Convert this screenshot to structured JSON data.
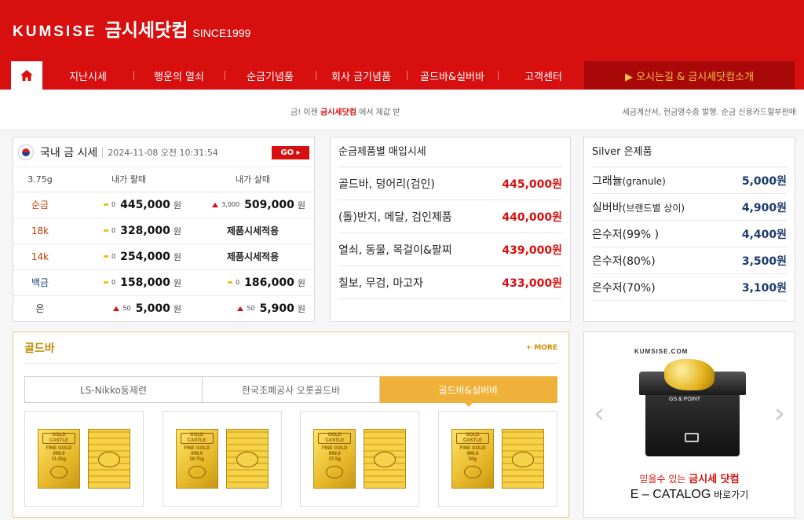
{
  "header": {
    "logo_en": "KUMSISE",
    "logo_ko": "금시세닷컴",
    "since": "SINCE1999"
  },
  "nav": {
    "items": [
      "지난시세",
      "행운의 열쇠",
      "순금기념품",
      "회사 금기념품",
      "골드바&실버바",
      "고객센터"
    ],
    "intro": "▶ 오시는길 & 금시세닷컴소개"
  },
  "notice": {
    "left_prefix": "금! 이젠 ",
    "left_brand": "금시세닷컴",
    "left_suffix": " 에서 제값 받",
    "right": "세금계산서, 현금영수증 발행. 순금 신용카드할부판매"
  },
  "gold_price": {
    "title": "국내 금 시세",
    "date": "2024-11-08 오전 10:31:54",
    "go_label": "GO ▸",
    "headers": [
      "3.75g",
      "내가 팔때",
      "내가 살때"
    ],
    "unit": "원",
    "rows": [
      {
        "name": "순금",
        "sell_change": "0",
        "sell": "445,000",
        "buy_change": "3,000",
        "buy": "509,000"
      },
      {
        "name": "18k",
        "sell_change": "0",
        "sell": "328,000",
        "buy_text": "제품시세적용"
      },
      {
        "name": "14k",
        "sell_change": "0",
        "sell": "254,000",
        "buy_text": "제품시세적용"
      },
      {
        "name": "백금",
        "sell_change": "0",
        "sell": "158,000",
        "buy_change": "0",
        "buy": "186,000"
      },
      {
        "name": "은",
        "sell_change": "50",
        "sell": "5,000",
        "buy_change": "50",
        "buy": "5,900"
      }
    ]
  },
  "buy_prices": {
    "title": "순금제품별 매입시세",
    "items": [
      {
        "name": "골드바, 덩어리(검인)",
        "price": "445,000원"
      },
      {
        "name": "(돌)반지, 메달, 검인제품",
        "price": "440,000원"
      },
      {
        "name": "열쇠, 동물, 목걸이&팔찌",
        "price": "439,000원"
      },
      {
        "name": "칠보, 무검, 마고자",
        "price": "433,000원"
      }
    ]
  },
  "silver": {
    "title": "Silver 은제품",
    "items": [
      {
        "name": "그래뉼",
        "sub": "(granule)",
        "price": "5,000원"
      },
      {
        "name": "실버바",
        "sub": "(브랜드별 상이)",
        "price": "4,900원"
      },
      {
        "name": "은수저(99% )",
        "sub": "",
        "price": "4,400원"
      },
      {
        "name": "은수저(80%)",
        "sub": "",
        "price": "3,500원"
      },
      {
        "name": "은수저(70%)",
        "sub": "",
        "price": "3,100원"
      }
    ]
  },
  "goldbar": {
    "title": "골드바",
    "more": "+ MORE",
    "tabs": [
      "LS-Nikko동제련",
      "한국조폐공사 오롯골드바",
      "골드바&실버바"
    ],
    "bar_label_1": "GOLD",
    "bar_label_2": "CASTLE",
    "bar_label_3": "FINE GOLD",
    "bar_label_4": "999.9",
    "weights": [
      "11.25g",
      "18.75g",
      "37.5g",
      "50g"
    ]
  },
  "catalog": {
    "brand": "KUMSISE.COM",
    "badge": "GS & POINT",
    "tagline_prefix": "믿을수 있는 ",
    "tagline_brand": "금시세 닷컴",
    "ecat": "E – CATALOG",
    "ecat_suffix": " 바로가기"
  },
  "colors": {
    "brand_red": "#d70f0f",
    "gold_accent": "#f0b13a",
    "price_blue": "#1d3b6e"
  }
}
